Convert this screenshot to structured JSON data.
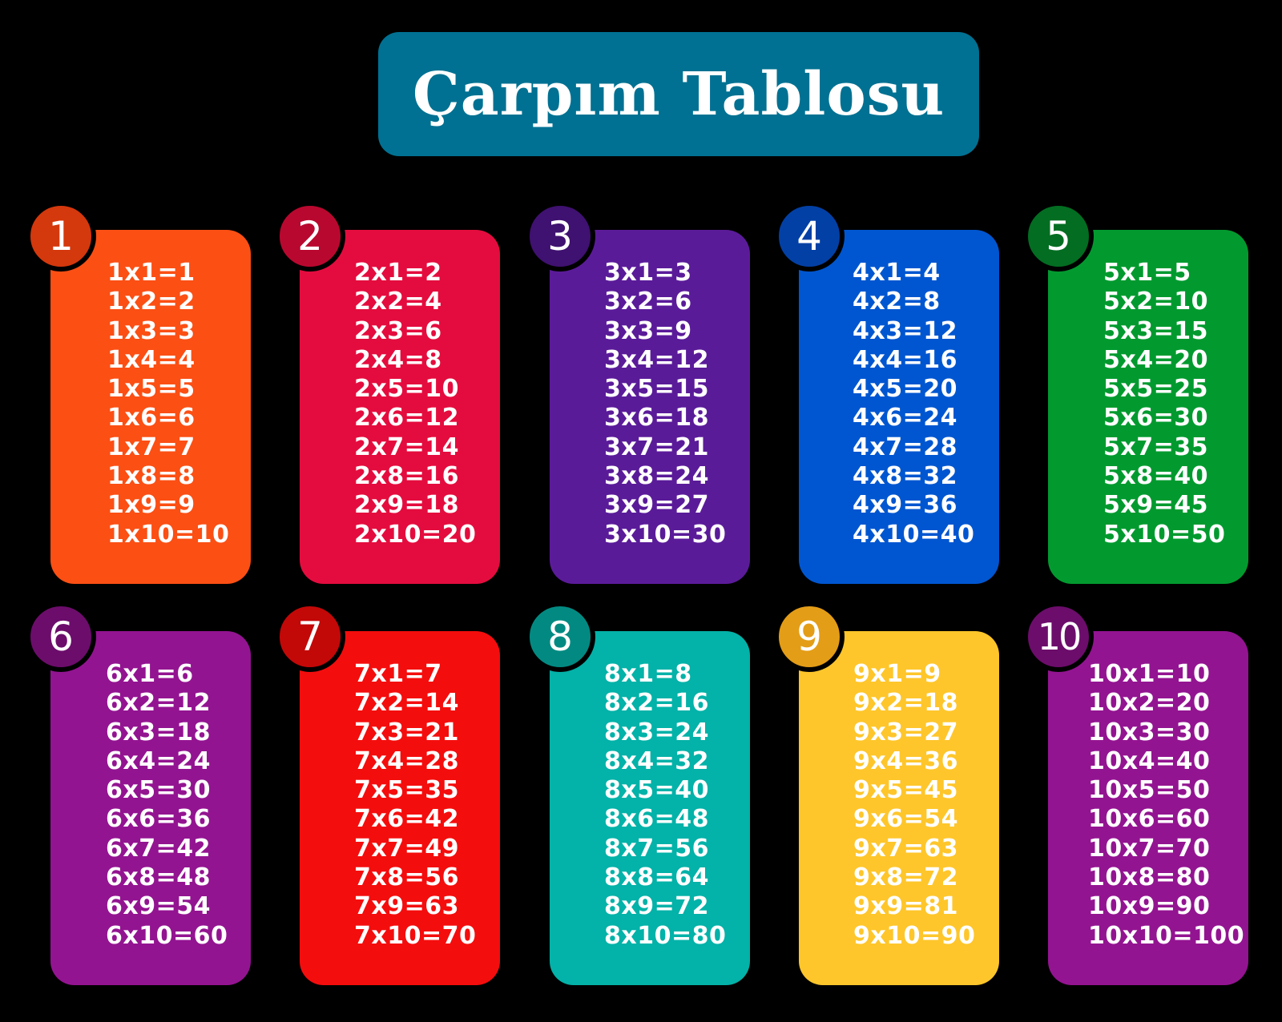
{
  "title": {
    "text": "Çarpım Tablosu",
    "color": "#007192"
  },
  "tables": [
    {
      "number": "1",
      "color": "#fb4f14",
      "badge_color": "#d4380d",
      "rows": [
        "1x1=1",
        "1x2=2",
        "1x3=3",
        "1x4=4",
        "1x5=5",
        "1x6=6",
        "1x7=7",
        "1x8=8",
        "1x9=9",
        "1x10=10"
      ]
    },
    {
      "number": "2",
      "color": "#e40c3e",
      "badge_color": "#b9082f",
      "rows": [
        "2x1=2",
        "2x2=4",
        "2x3=6",
        "2x4=8",
        "2x5=10",
        "2x6=12",
        "2x7=14",
        "2x8=16",
        "2x9=18",
        "2x10=20"
      ]
    },
    {
      "number": "3",
      "color": "#5a1b99",
      "badge_color": "#3f1170",
      "rows": [
        "3x1=3",
        "3x2=6",
        "3x3=9",
        "3x4=12",
        "3x5=15",
        "3x6=18",
        "3x7=21",
        "3x8=24",
        "3x9=27",
        "3x10=30"
      ]
    },
    {
      "number": "4",
      "color": "#0056d0",
      "badge_color": "#0340a5",
      "rows": [
        "4x1=4",
        "4x2=8",
        "4x3=12",
        "4x4=16",
        "4x5=20",
        "4x6=24",
        "4x7=28",
        "4x8=32",
        "4x9=36",
        "4x10=40"
      ]
    },
    {
      "number": "5",
      "color": "#029a2f",
      "badge_color": "#036d22",
      "rows": [
        "5x1=5",
        "5x2=10",
        "5x3=15",
        "5x4=20",
        "5x5=25",
        "5x6=30",
        "5x7=35",
        "5x8=40",
        "5x9=45",
        "5x10=50"
      ]
    },
    {
      "number": "6",
      "color": "#931491",
      "badge_color": "#6c0d6b",
      "rows": [
        "6x1=6",
        "6x2=12",
        "6x3=18",
        "6x4=24",
        "6x5=30",
        "6x6=36",
        "6x7=42",
        "6x8=48",
        "6x9=54",
        "6x10=60"
      ]
    },
    {
      "number": "7",
      "color": "#f40d0d",
      "badge_color": "#c30808",
      "rows": [
        "7x1=7",
        "7x2=14",
        "7x3=21",
        "7x4=28",
        "7x5=35",
        "7x6=42",
        "7x7=49",
        "7x8=56",
        "7x9=63",
        "7x10=70"
      ]
    },
    {
      "number": "8",
      "color": "#03b2a8",
      "badge_color": "#028a82",
      "rows": [
        "8x1=8",
        "8x2=16",
        "8x3=24",
        "8x4=32",
        "8x5=40",
        "8x6=48",
        "8x7=56",
        "8x8=64",
        "8x9=72",
        "8x10=80"
      ]
    },
    {
      "number": "9",
      "color": "#fec62b",
      "badge_color": "#e39d17",
      "rows": [
        "9x1=9",
        "9x2=18",
        "9x3=27",
        "9x4=36",
        "9x5=45",
        "9x6=54",
        "9x7=63",
        "9x8=72",
        "9x9=81",
        "9x10=90"
      ]
    },
    {
      "number": "10",
      "color": "#931491",
      "badge_color": "#6c0d6b",
      "rows": [
        "10x1=10",
        "10x2=20",
        "10x3=30",
        "10x4=40",
        "10x5=50",
        "10x6=60",
        "10x7=70",
        "10x8=80",
        "10x9=90",
        "10x10=100"
      ]
    }
  ]
}
